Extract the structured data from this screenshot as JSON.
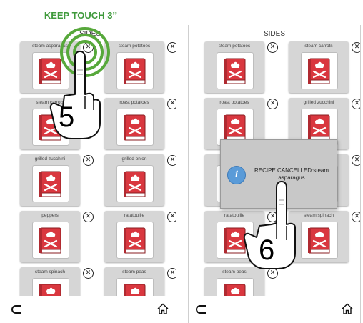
{
  "instruction": "KEEP TOUCH 3’’",
  "colors": {
    "instruction": "#3f9a3c",
    "card_bg": "#d6d6d6",
    "book_red": "#d9373f",
    "info_blue": "#5a9bd8",
    "ripple": "#57a83b"
  },
  "left_panel": {
    "title": "SIDES",
    "items": [
      {
        "label": "steam asparagus"
      },
      {
        "label": "steam potatoes"
      },
      {
        "label": "steam carrots"
      },
      {
        "label": "roast potatoes"
      },
      {
        "label": "grilled zucchini"
      },
      {
        "label": "grilled onion"
      },
      {
        "label": "peppers"
      },
      {
        "label": "ratatouille"
      },
      {
        "label": "steam spinach"
      },
      {
        "label": "steam peas"
      }
    ],
    "step": "5"
  },
  "right_panel": {
    "title": "SIDES",
    "items": [
      {
        "label": "steam potatoes"
      },
      {
        "label": "steam carrots"
      },
      {
        "label": "roast potatoes"
      },
      {
        "label": "grilled zucchini"
      },
      {
        "label": ""
      },
      {
        "label": ""
      },
      {
        "label": "ratatouille"
      },
      {
        "label": "steam spinach"
      },
      {
        "label": "steam peas"
      }
    ],
    "dialog": {
      "icon": "info-icon",
      "message": "RECIPE CANCELLED:steam asparagus"
    },
    "step": "6"
  },
  "nav": {
    "back_icon": "back-arrow-icon",
    "home_icon": "home-icon"
  }
}
